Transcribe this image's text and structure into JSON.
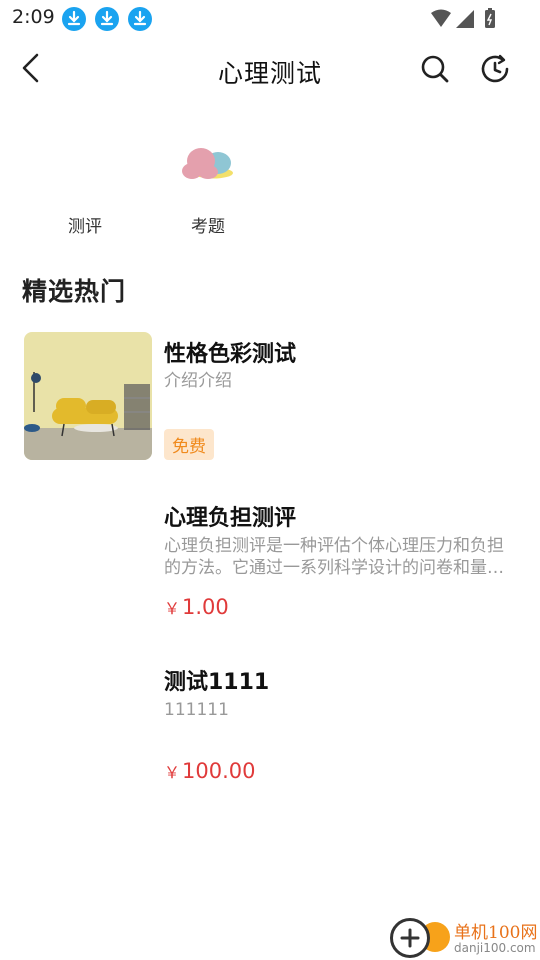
{
  "status_bar": {
    "time": "2:09",
    "icons": [
      "download-icon",
      "download-icon",
      "download-icon",
      "wifi-icon",
      "signal-icon",
      "battery-icon"
    ]
  },
  "nav": {
    "title": "心理测试",
    "icons": [
      "back-icon",
      "search-icon",
      "history-icon"
    ]
  },
  "categories": [
    {
      "label": "测评",
      "icon": ""
    },
    {
      "label": "考题",
      "icon": "cloud-illustration-icon"
    }
  ],
  "section": {
    "title": "精选热门"
  },
  "items": [
    {
      "title": "性格色彩测试",
      "desc": "介绍介绍",
      "badge": "免费",
      "has_image": true
    },
    {
      "title": "心理负担测评",
      "desc": "心理负担测评是一种评估个体心理压力和负担的方法。它通过一系列科学设计的问卷和量表，帮助了解个体的心理状态。",
      "price_symbol": "￥",
      "price": "1.00"
    },
    {
      "title": "测试1111",
      "desc": "111111",
      "price_symbol": "￥",
      "price": "100.00"
    }
  ],
  "watermark": {
    "name": "单机100网",
    "url": "danji100.com"
  },
  "colors": {
    "accent_price": "#e03a3a",
    "badge_bg": "#fde6cc",
    "badge_text": "#f08a1c",
    "download_blue": "#1aa3f0"
  }
}
